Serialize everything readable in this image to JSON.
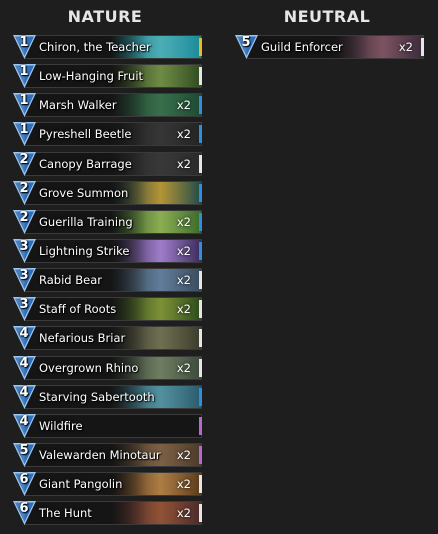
{
  "columns": {
    "nature": {
      "title": "NATURE",
      "cards": [
        {
          "cost": "1",
          "name": "Chiron, the Teacher",
          "qty": "",
          "rarity_color": "#f0b81f",
          "art": [
            "#1a8a9a",
            "#53c1c8"
          ]
        },
        {
          "cost": "1",
          "name": "Low-Hanging Fruit",
          "qty": "",
          "rarity_color": "#e6e6e6",
          "art": [
            "#2f4a1f",
            "#7a9a4a"
          ]
        },
        {
          "cost": "1",
          "name": "Marsh Walker",
          "qty": "x2",
          "rarity_color": "#2e8fe0",
          "art": [
            "#1d4a32",
            "#3d7a52"
          ]
        },
        {
          "cost": "1",
          "name": "Pyreshell Beetle",
          "qty": "x2",
          "rarity_color": "#2e8fe0",
          "art": [
            "#232323",
            "#3a3a3a"
          ]
        },
        {
          "cost": "2",
          "name": "Canopy Barrage",
          "qty": "x2",
          "rarity_color": "#e6e6e6",
          "art": [
            "#2a2a2a",
            "#3d3d3d"
          ]
        },
        {
          "cost": "2",
          "name": "Grove Summon",
          "qty": "",
          "rarity_color": "#2e8fe0",
          "art": [
            "#1e4a4a",
            "#c8a43a"
          ]
        },
        {
          "cost": "2",
          "name": "Guerilla Training",
          "qty": "x2",
          "rarity_color": "#2e8fe0",
          "art": [
            "#3a6a2a",
            "#9ac05a"
          ]
        },
        {
          "cost": "3",
          "name": "Lightning Strike",
          "qty": "x2",
          "rarity_color": "#2e8fe0",
          "art": [
            "#3a2a5a",
            "#b08ae0"
          ]
        },
        {
          "cost": "3",
          "name": "Rabid Bear",
          "qty": "x2",
          "rarity_color": "#e6e6e6",
          "art": [
            "#3a4a5a",
            "#6a8aaa"
          ]
        },
        {
          "cost": "3",
          "name": "Staff of Roots",
          "qty": "x2",
          "rarity_color": "#e6e6e6",
          "art": [
            "#2a4a1a",
            "#8aa03a"
          ]
        },
        {
          "cost": "4",
          "name": "Nefarious Briar",
          "qty": "",
          "rarity_color": "#e6e6e6",
          "art": [
            "#3a3a2a",
            "#7a7a5a"
          ]
        },
        {
          "cost": "4",
          "name": "Overgrown Rhino",
          "qty": "x2",
          "rarity_color": "#e6e6e6",
          "art": [
            "#3a4a3a",
            "#7a8a6a"
          ]
        },
        {
          "cost": "4",
          "name": "Starving Sabertooth",
          "qty": "",
          "rarity_color": "#2e8fe0",
          "art": [
            "#2a5a6a",
            "#5aa0b0"
          ]
        },
        {
          "cost": "4",
          "name": "Wildfire",
          "qty": "",
          "rarity_color": "#b56ad0",
          "art": [
            "#151515",
            "#151515"
          ]
        },
        {
          "cost": "5",
          "name": "Valewarden Minotaur",
          "qty": "x2",
          "rarity_color": "#b56ad0",
          "art": [
            "#4a3a2a",
            "#8a6a4a"
          ]
        },
        {
          "cost": "6",
          "name": "Giant Pangolin",
          "qty": "x2",
          "rarity_color": "#e6e6e6",
          "art": [
            "#5a3a1a",
            "#c08a4a"
          ]
        },
        {
          "cost": "6",
          "name": "The Hunt",
          "qty": "x2",
          "rarity_color": "#e6e6e6",
          "art": [
            "#4a2a2a",
            "#a05a3a"
          ]
        }
      ]
    },
    "neutral": {
      "title": "NEUTRAL",
      "cards": [
        {
          "cost": "5",
          "name": "Guild Enforcer",
          "qty": "x2",
          "rarity_color": "#e6e6e6",
          "art": [
            "#3a2a3a",
            "#8a5a6a"
          ]
        }
      ]
    }
  },
  "colors": {
    "background": "#1e1e1e",
    "gem_fill": "#2f6fb8",
    "gem_edge": "#9fc6ee",
    "rarity_common": "#e6e6e6",
    "rarity_rare": "#2e8fe0",
    "rarity_epic": "#b56ad0",
    "rarity_legendary": "#f0b81f"
  }
}
